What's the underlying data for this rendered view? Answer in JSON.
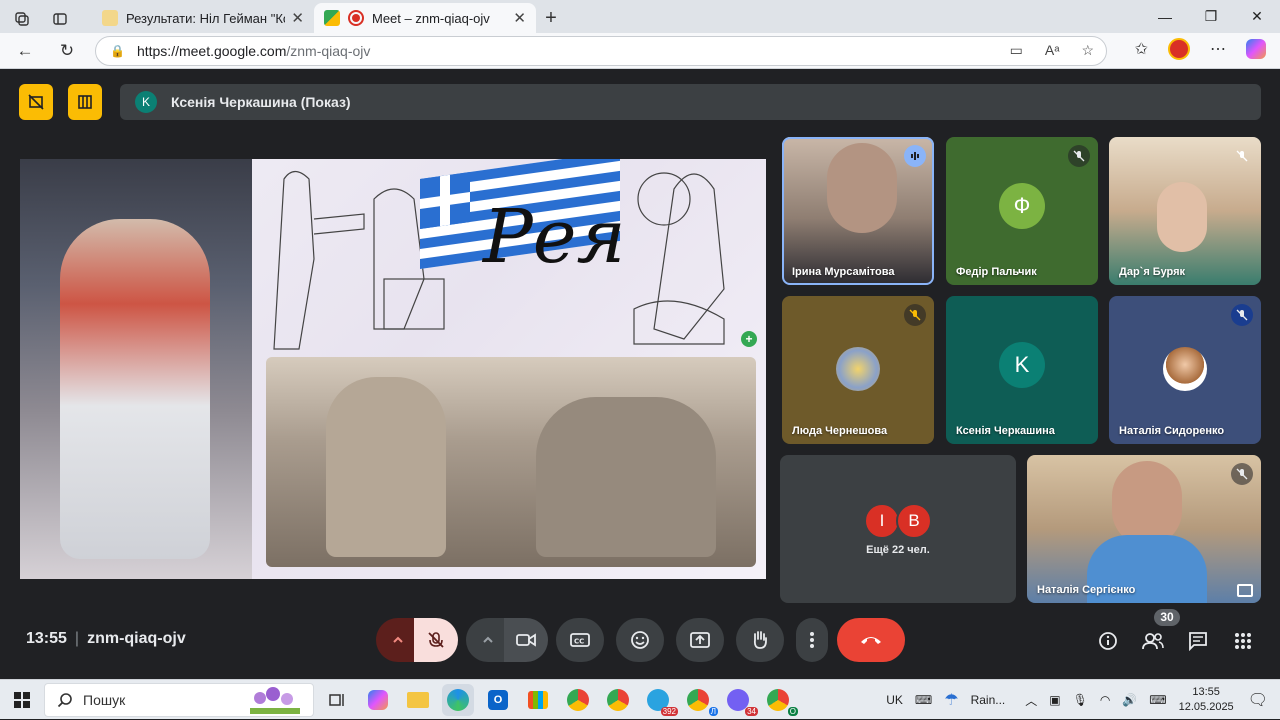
{
  "browser": {
    "tabs": [
      {
        "title": "Результати: Ніл Гейман \"Коралін\"",
        "active": false
      },
      {
        "title": "Meet – znm-qiaq-ojv",
        "active": true
      }
    ],
    "url_host": "https://meet.google.com",
    "url_path": "/znm-qiaq-ojv"
  },
  "meet": {
    "presenter": {
      "initial": "K",
      "name": "Ксенія Черкашина (Показ)"
    },
    "slide_title": "Рея",
    "tiles": [
      {
        "name": "Ірина Мурсамітова",
        "type": "video",
        "speaking": true
      },
      {
        "name": "Федір Пальчик",
        "type": "letter",
        "initial": "Ф",
        "color": "#7cb342"
      },
      {
        "name": "Дар`я Буряк",
        "type": "video"
      },
      {
        "name": "Люда Чернешова",
        "type": "photo"
      },
      {
        "name": "Ксенія Черкашина",
        "type": "letter",
        "initial": "K",
        "color": "#0b8074"
      },
      {
        "name": "Наталія Сидоренко",
        "type": "photo"
      }
    ],
    "more": {
      "avatars": [
        "І",
        "В"
      ],
      "label": "Ещё 22 чел."
    },
    "bottom_tile_name": "Наталія Сергієнко",
    "time": "13:55",
    "meeting_code": "znm-qiaq-ojv",
    "participants_count": "30"
  },
  "taskbar": {
    "search_placeholder": "Пошук",
    "lang": "UK",
    "weather": "Rain...",
    "badges": {
      "telegram": "392",
      "viber": "34",
      "chrome_profile": "Л",
      "chrome_profile2": "О"
    },
    "clock_time": "13:55",
    "clock_date": "12.05.2025"
  }
}
